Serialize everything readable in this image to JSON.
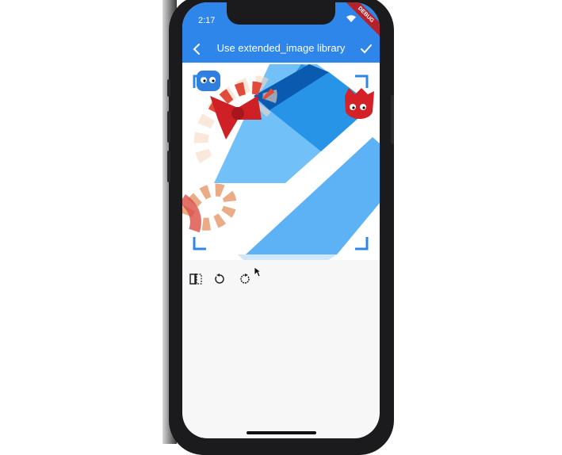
{
  "status_bar": {
    "time": "2:17",
    "debug_banner": "DEBUG"
  },
  "app_bar": {
    "title": "Use extended_image library",
    "back_icon": "chevron-left-icon",
    "confirm_icon": "check-icon"
  },
  "toolbar": {
    "buttons": [
      {
        "icon": "flip-icon"
      },
      {
        "icon": "rotate-left-icon"
      },
      {
        "icon": "rotate-right-icon"
      }
    ]
  },
  "colors": {
    "accent": "#2f86ea",
    "crop_corner": "#2f86ea",
    "background": "#f7f7f8"
  }
}
